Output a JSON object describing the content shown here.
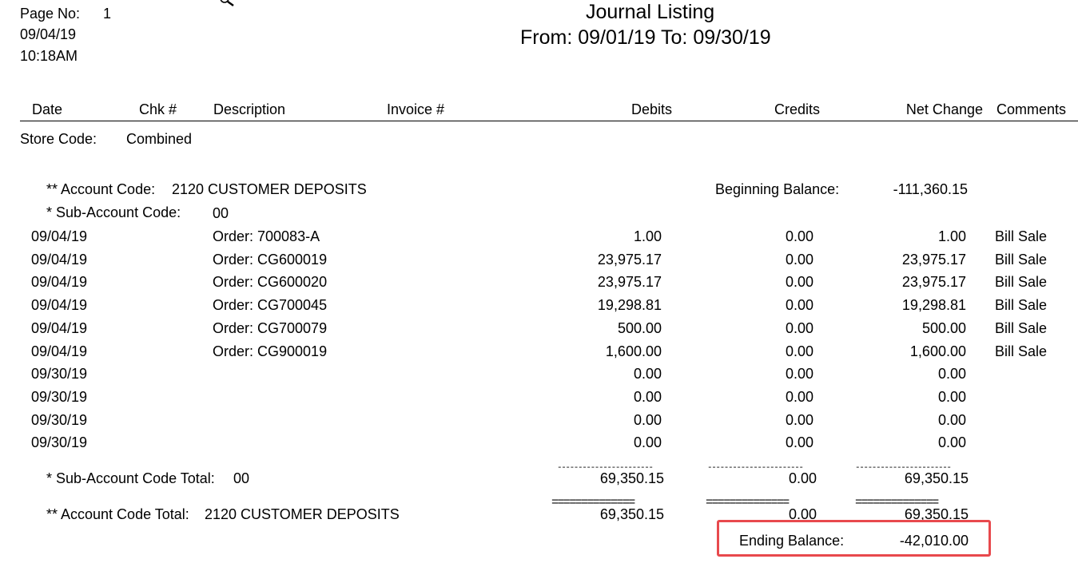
{
  "header": {
    "page_label": "Page No:",
    "page_number": "1",
    "date": "09/04/19",
    "time": "10:18AM",
    "title": "Journal Listing",
    "date_range": "From: 09/01/19 To: 09/30/19"
  },
  "columns": {
    "date": "Date",
    "check": "Chk #",
    "description": "Description",
    "invoice": "Invoice #",
    "debits": "Debits",
    "credits": "Credits",
    "net_change": "Net Change",
    "comments": "Comments"
  },
  "store": {
    "label": "Store Code:",
    "value": "Combined"
  },
  "account": {
    "label": "** Account Code:",
    "value": "2120 CUSTOMER DEPOSITS",
    "beginning_label": "Beginning Balance:",
    "beginning_value": "-111,360.15"
  },
  "sub_account": {
    "label": "* Sub-Account Code:",
    "value": "00"
  },
  "rows": [
    {
      "date": "09/04/19",
      "description": "Order: 700083-A",
      "debits": "1.00",
      "credits": "0.00",
      "net": "1.00",
      "comment": "Bill Sale"
    },
    {
      "date": "09/04/19",
      "description": "Order: CG600019",
      "debits": "23,975.17",
      "credits": "0.00",
      "net": "23,975.17",
      "comment": "Bill Sale"
    },
    {
      "date": "09/04/19",
      "description": "Order: CG600020",
      "debits": "23,975.17",
      "credits": "0.00",
      "net": "23,975.17",
      "comment": "Bill Sale"
    },
    {
      "date": "09/04/19",
      "description": "Order: CG700045",
      "debits": "19,298.81",
      "credits": "0.00",
      "net": "19,298.81",
      "comment": "Bill Sale"
    },
    {
      "date": "09/04/19",
      "description": "Order: CG700079",
      "debits": "500.00",
      "credits": "0.00",
      "net": "500.00",
      "comment": "Bill Sale"
    },
    {
      "date": "09/04/19",
      "description": "Order: CG900019",
      "debits": "1,600.00",
      "credits": "0.00",
      "net": "1,600.00",
      "comment": "Bill Sale"
    },
    {
      "date": "09/30/19",
      "description": "",
      "debits": "0.00",
      "credits": "0.00",
      "net": "0.00",
      "comment": ""
    },
    {
      "date": "09/30/19",
      "description": "",
      "debits": "0.00",
      "credits": "0.00",
      "net": "0.00",
      "comment": ""
    },
    {
      "date": "09/30/19",
      "description": "",
      "debits": "0.00",
      "credits": "0.00",
      "net": "0.00",
      "comment": ""
    },
    {
      "date": "09/30/19",
      "description": "",
      "debits": "0.00",
      "credits": "0.00",
      "net": "0.00",
      "comment": ""
    }
  ],
  "sub_total": {
    "label": "* Sub-Account Code Total:",
    "value": "00",
    "debits": "69,350.15",
    "credits": "0.00",
    "net": "69,350.15"
  },
  "account_total": {
    "label": "** Account Code Total:",
    "value": "2120 CUSTOMER DEPOSITS",
    "debits": "69,350.15",
    "credits": "0.00",
    "net": "69,350.15"
  },
  "ending": {
    "label": "Ending Balance:",
    "value": "-42,010.00"
  },
  "rules": {
    "dash_debits": "-----------------------",
    "dash_credits": "-----------------------",
    "dash_net": "-----------------------",
    "eq_debits": "==============",
    "eq_credits": "==============",
    "eq_net": "=============="
  },
  "colors": {
    "highlight": "#e8494d"
  },
  "icons": {
    "cursor": "magnifier-cursor-icon"
  }
}
